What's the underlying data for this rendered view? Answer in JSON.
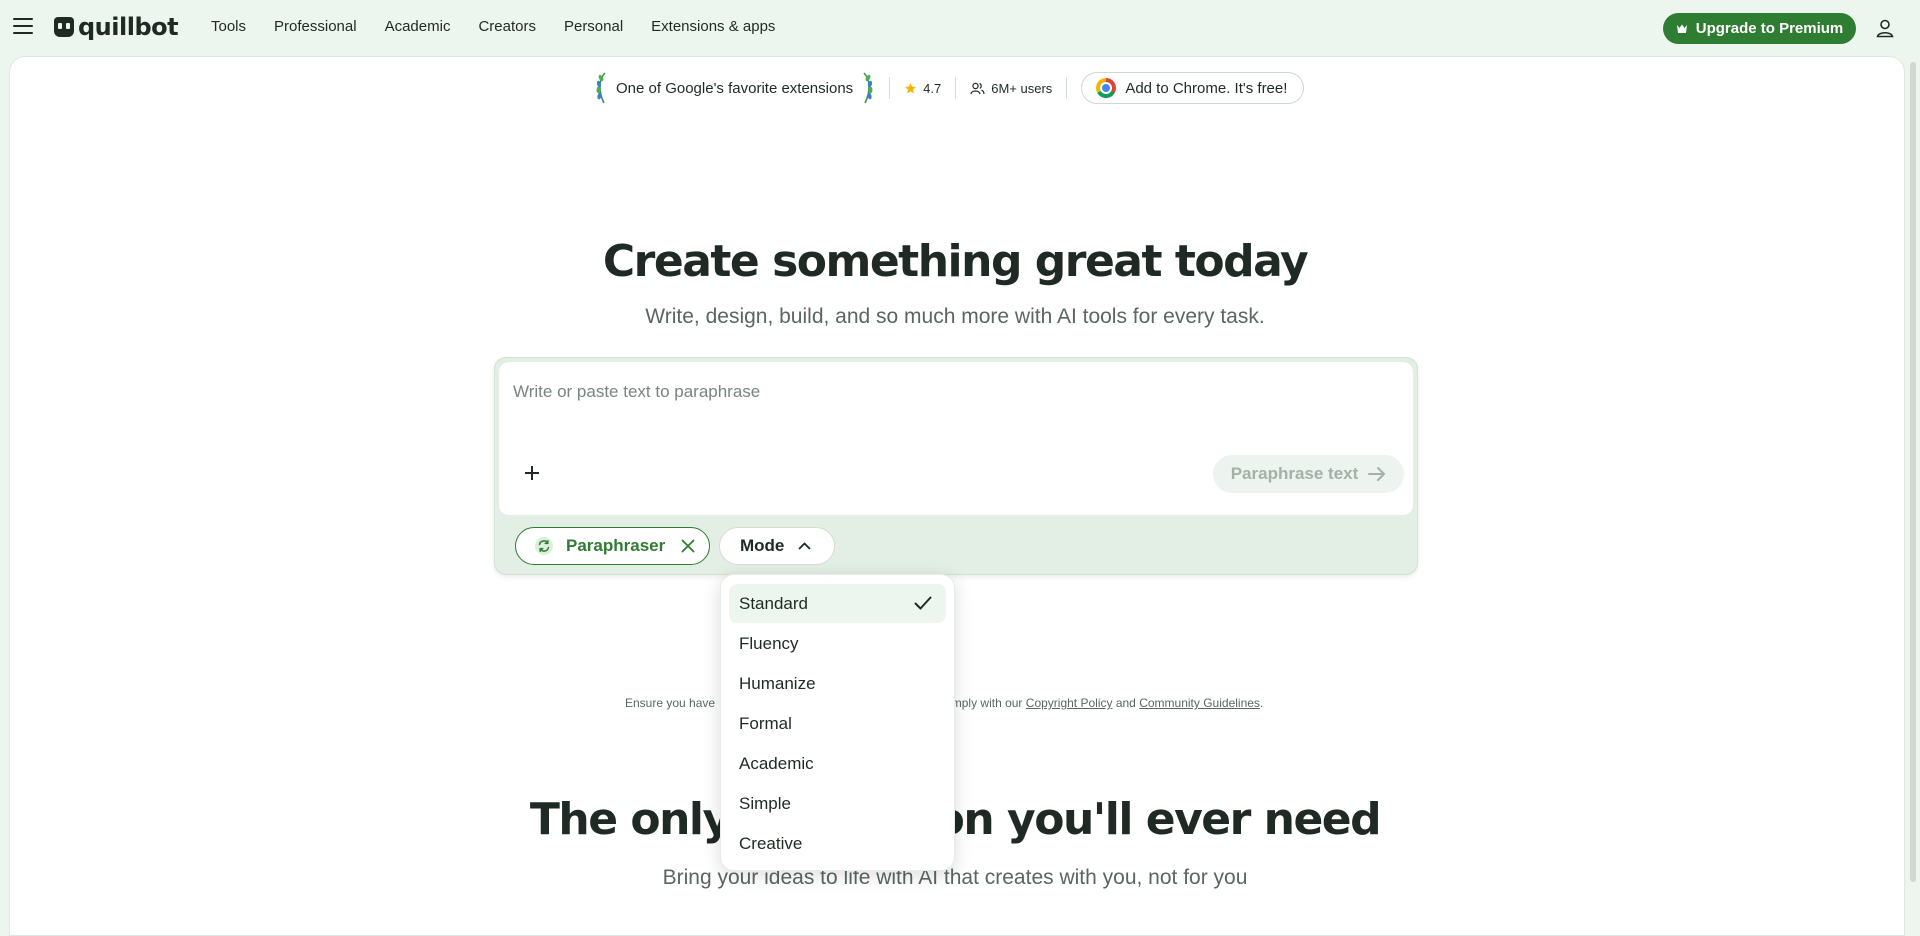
{
  "nav": {
    "brand": "quillbot",
    "links": [
      "Tools",
      "Professional",
      "Academic",
      "Creators",
      "Personal",
      "Extensions & apps"
    ],
    "upgrade_label": "Upgrade to Premium",
    "menu_icon": "hamburger-icon",
    "account_icon": "user-icon"
  },
  "promo": {
    "favorite_text": "One of Google's favorite extensions",
    "rating": "4.7",
    "users": "6M+ users",
    "chrome_cta": "Add to Chrome. It's free!"
  },
  "hero": {
    "title": "Create something great today",
    "subtitle": "Write, design, build, and so much more with AI tools for every task."
  },
  "editor": {
    "placeholder": "Write or paste text to paraphrase",
    "value": "",
    "submit_label": "Paraphrase text",
    "tool_chip": "Paraphraser",
    "mode_label": "Mode"
  },
  "mode_menu": {
    "selected": "Standard",
    "options": [
      "Standard",
      "Fluency",
      "Humanize",
      "Formal",
      "Academic",
      "Simple",
      "Creative"
    ]
  },
  "disclaimer": {
    "prefix": "Ensure you have",
    "middle": "omply with our",
    "copyright_link": "Copyright Policy",
    "and": "and",
    "guidelines_link": "Community Guidelines",
    "suffix": "."
  },
  "section": {
    "title": "The only AI solution you'll ever need",
    "subtitle": "Bring your ideas to life with AI that creates with you, not for you"
  },
  "colors": {
    "brand_green": "#2e7d32",
    "page_bg": "#edf6ee",
    "rating_star": "#f4b400"
  }
}
